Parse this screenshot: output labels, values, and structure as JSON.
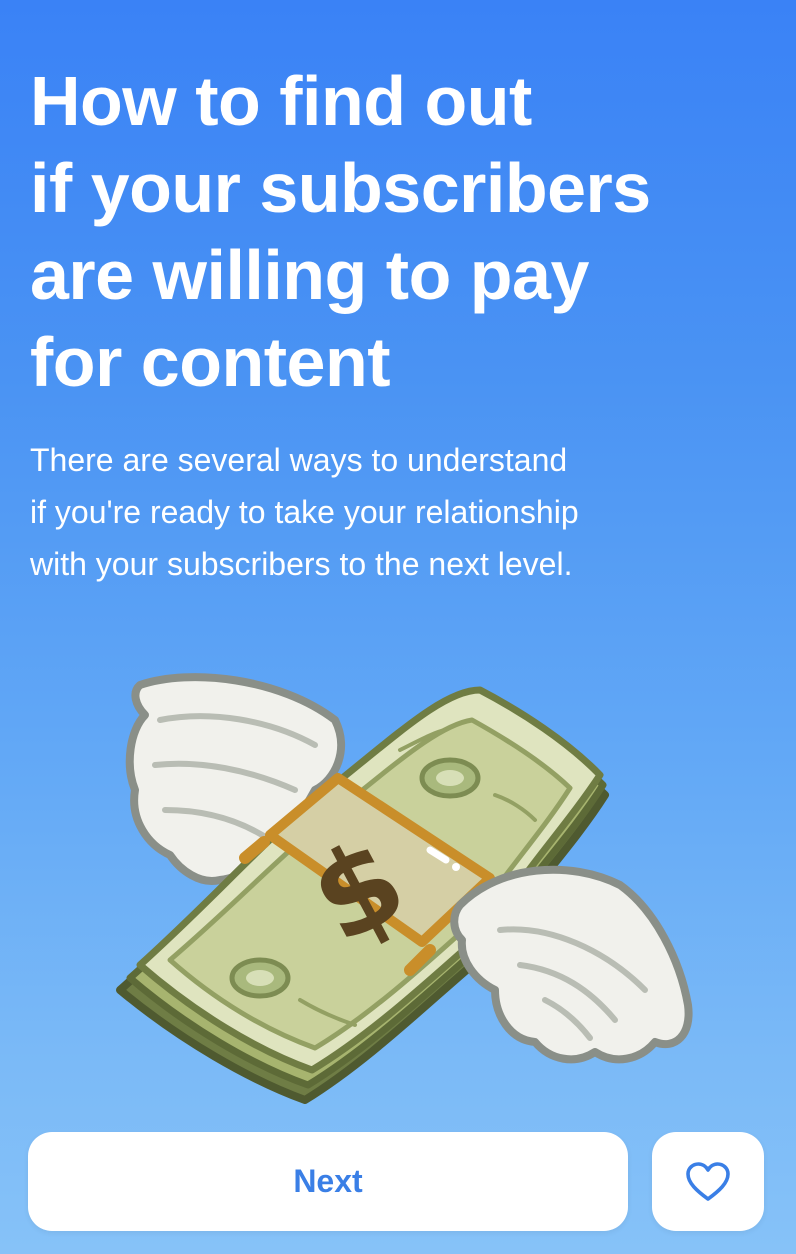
{
  "title_lines": [
    "How to find out",
    "if your subscribers",
    "are willing to pay",
    "for content"
  ],
  "subtitle_lines": [
    "There are several ways to understand",
    "if you're ready to take your relationship",
    "with your subscribers to the next level."
  ],
  "illustration": {
    "icon": "money-with-wings-icon",
    "symbol": "$"
  },
  "next_button": {
    "label": "Next"
  },
  "like_button": {
    "icon": "heart-icon"
  },
  "colors": {
    "background_top": "#3a82f6",
    "background_bottom": "#86c2f8",
    "accent": "#3a7fe6",
    "button_bg": "#ffffff"
  }
}
